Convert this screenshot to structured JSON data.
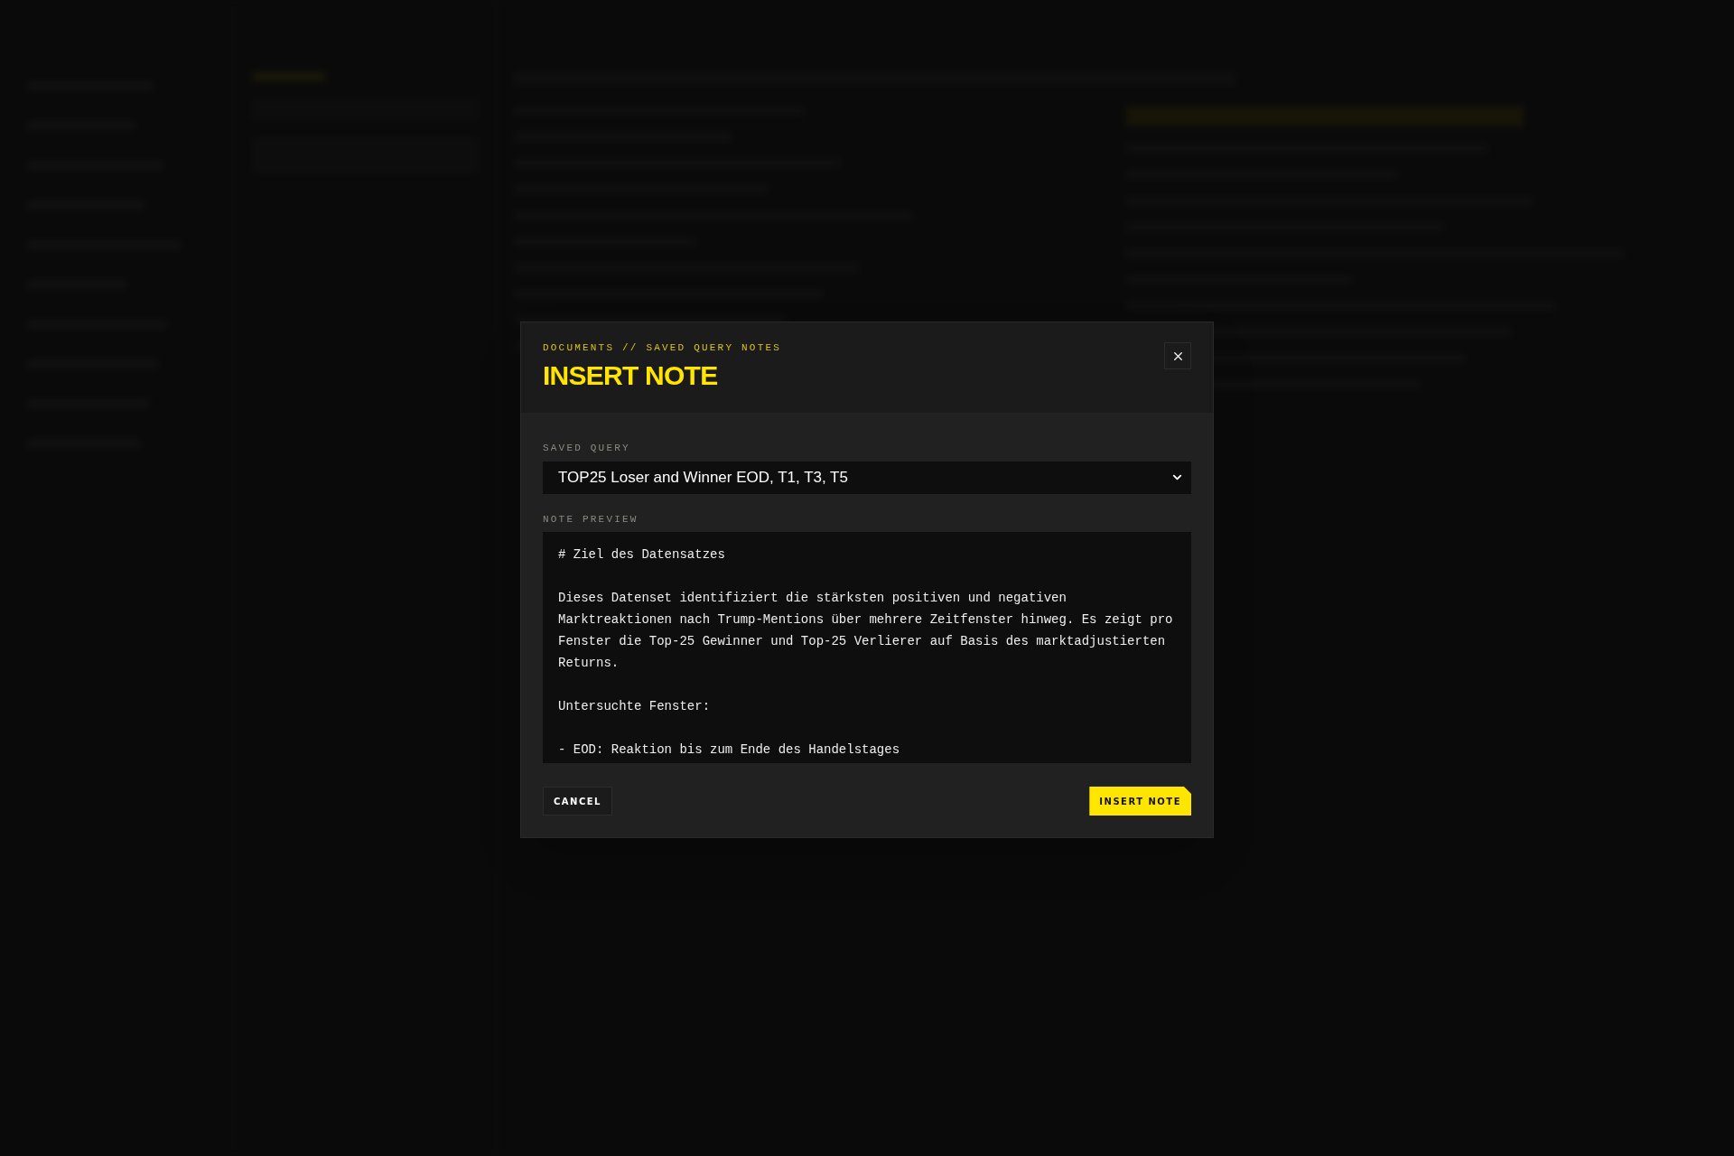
{
  "modal": {
    "breadcrumb": "DOCUMENTS // SAVED QUERY NOTES",
    "title": "INSERT NOTE",
    "saved_query": {
      "label": "SAVED QUERY",
      "value": "TOP25 Loser and Winner EOD, T1, T3, T5"
    },
    "note_preview": {
      "label": "NOTE PREVIEW",
      "paragraphs": [
        "# Ziel des Datensatzes",
        "Dieses Datenset identifiziert die stärksten positiven und negativen Marktreaktionen nach Trump-Mentions über mehrere Zeitfenster hinweg. Es zeigt pro Fenster die Top-25 Gewinner und Top-25 Verlierer auf Basis des marktadjustierten Returns.",
        "Untersuchte Fenster:",
        "- EOD: Reaktion bis zum Ende des Handelstages"
      ]
    },
    "buttons": [
      {
        "label": "CANCEL",
        "kind": "secondary"
      },
      {
        "label": "INSERT NOTE",
        "kind": "primary"
      }
    ]
  }
}
